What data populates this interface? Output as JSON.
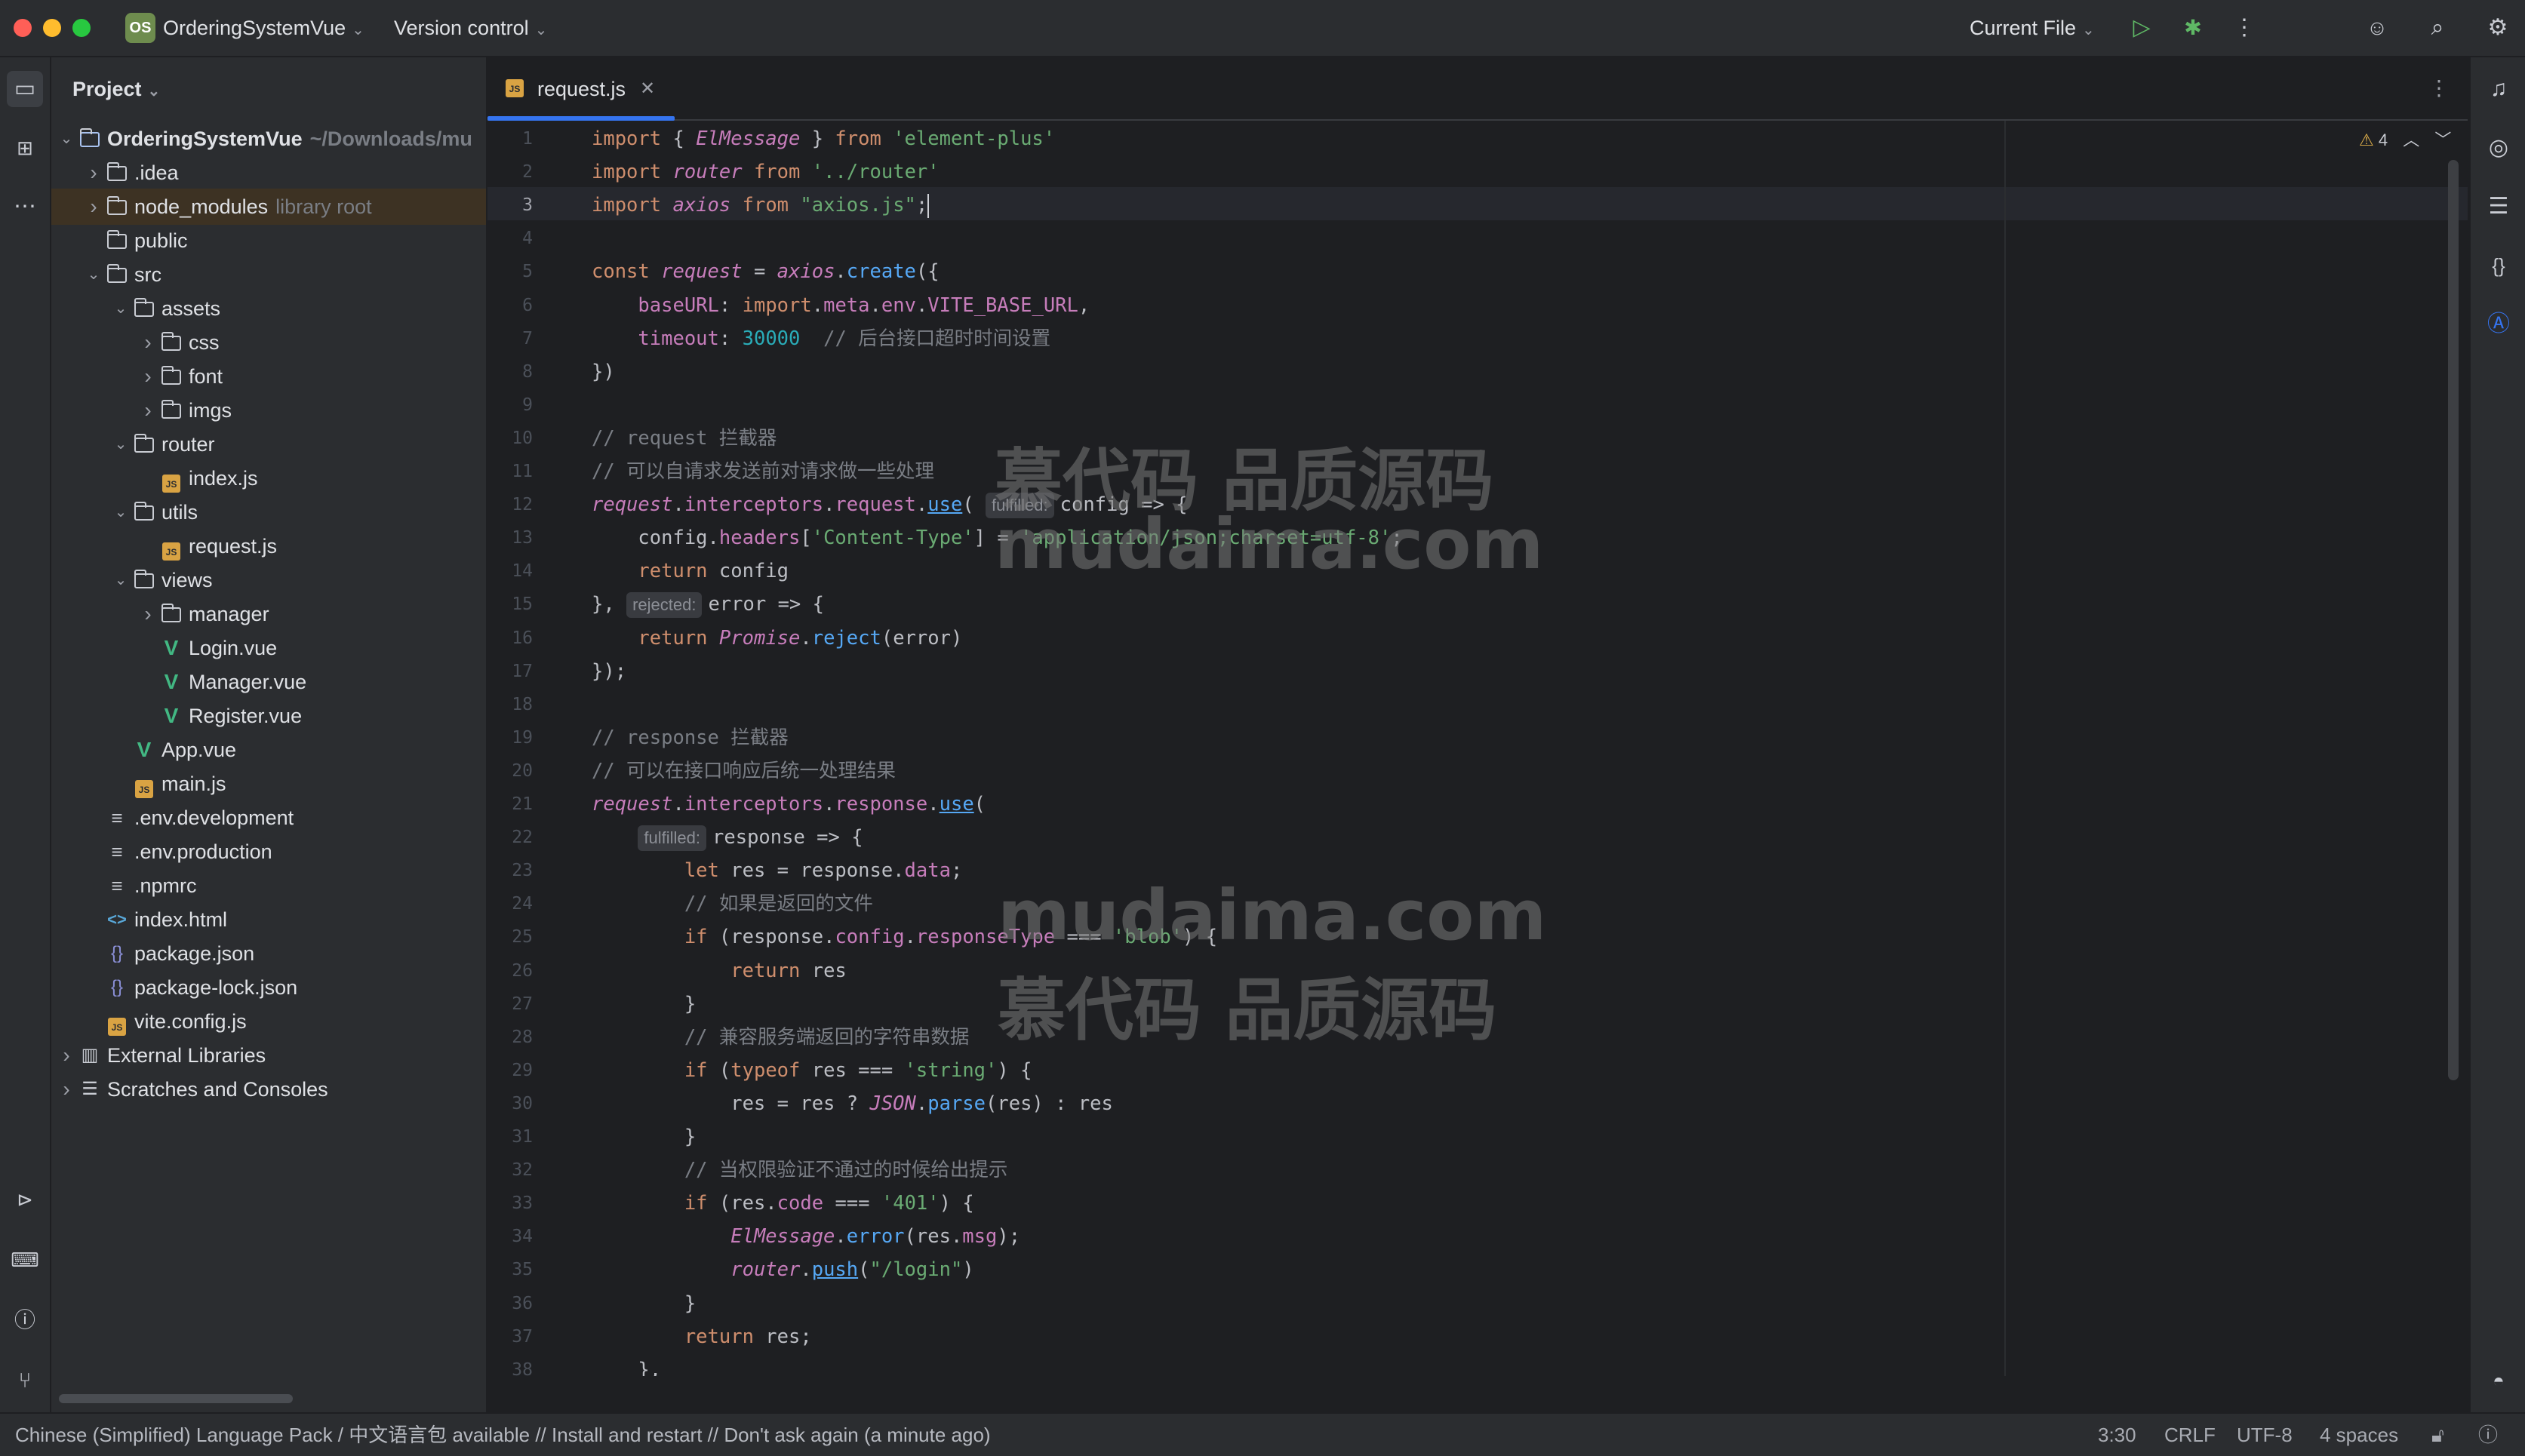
{
  "titlebar": {
    "project_badge": "OS",
    "project_name": "OrderingSystemVue",
    "vcs": "Version control",
    "run_config": "Current File"
  },
  "project_panel": {
    "header": "Project",
    "tree": [
      {
        "label": "OrderingSystemVue",
        "sub": "~/Downloads/mu",
        "icon": "project-folder-icon",
        "level": 0,
        "expanded": true,
        "bold": true
      },
      {
        "label": ".idea",
        "icon": "folder-icon",
        "level": 1,
        "collapsed": true
      },
      {
        "label": "node_modules",
        "sub": "library root",
        "icon": "folder-icon",
        "level": 1,
        "collapsed": true
      },
      {
        "label": "public",
        "icon": "folder-icon",
        "level": 1
      },
      {
        "label": "src",
        "icon": "folder-icon",
        "level": 1,
        "expanded": true
      },
      {
        "label": "assets",
        "icon": "folder-icon",
        "level": 2,
        "expanded": true
      },
      {
        "label": "css",
        "icon": "folder-icon",
        "level": 3,
        "collapsed": true
      },
      {
        "label": "font",
        "icon": "folder-icon",
        "level": 3,
        "collapsed": true
      },
      {
        "label": "imgs",
        "icon": "folder-icon",
        "level": 3,
        "collapsed": true
      },
      {
        "label": "router",
        "icon": "folder-icon",
        "level": 2,
        "expanded": true
      },
      {
        "label": "index.js",
        "icon": "js-file-icon",
        "level": 3
      },
      {
        "label": "utils",
        "icon": "folder-icon",
        "level": 2,
        "expanded": true
      },
      {
        "label": "request.js",
        "icon": "js-file-icon",
        "level": 3
      },
      {
        "label": "views",
        "icon": "folder-icon",
        "level": 2,
        "expanded": true
      },
      {
        "label": "manager",
        "icon": "folder-icon",
        "level": 3,
        "collapsed": true
      },
      {
        "label": "Login.vue",
        "icon": "vue-file-icon",
        "level": 3
      },
      {
        "label": "Manager.vue",
        "icon": "vue-file-icon",
        "level": 3
      },
      {
        "label": "Register.vue",
        "icon": "vue-file-icon",
        "level": 3
      },
      {
        "label": "App.vue",
        "icon": "vue-file-icon",
        "level": 2
      },
      {
        "label": "main.js",
        "icon": "js-file-icon",
        "level": 2
      },
      {
        "label": ".env.development",
        "icon": "text-file-icon",
        "level": 1
      },
      {
        "label": ".env.production",
        "icon": "text-file-icon",
        "level": 1
      },
      {
        "label": ".npmrc",
        "icon": "text-file-icon",
        "level": 1
      },
      {
        "label": "index.html",
        "icon": "html-file-icon",
        "level": 1
      },
      {
        "label": "package.json",
        "icon": "json-file-icon",
        "level": 1
      },
      {
        "label": "package-lock.json",
        "icon": "json-file-icon",
        "level": 1
      },
      {
        "label": "vite.config.js",
        "icon": "js-file-icon",
        "level": 1
      },
      {
        "label": "External Libraries",
        "icon": "library-icon",
        "level": 0,
        "collapsed": true
      },
      {
        "label": "Scratches and Consoles",
        "icon": "scratches-icon",
        "level": 0,
        "collapsed": true
      }
    ]
  },
  "editor": {
    "tab_label": "request.js",
    "warnings_count": "4",
    "current_line": 3,
    "lines": [
      "import { ElMessage } from 'element-plus'",
      "import router from '../router'",
      "import axios from \"axios.js\";",
      "",
      "const request = axios.create({",
      "    baseURL: import.meta.env.VITE_BASE_URL,",
      "    timeout: 30000  // 后台接口超时时间设置",
      "})",
      "",
      "// request 拦截器",
      "// 可以自请求发送前对请求做一些处理",
      "request.interceptors.request.use( config => {",
      "    config.headers['Content-Type'] = 'application/json;charset=utf-8';",
      "    return config",
      "},  error => {",
      "    return Promise.reject(error)",
      "});",
      "",
      "// response 拦截器",
      "// 可以在接口响应后统一处理结果",
      "request.interceptors.response.use(",
      "     response => {",
      "        let res = response.data;",
      "        // 如果是返回的文件",
      "        if (response.config.responseType === 'blob') {",
      "            return res",
      "        }",
      "        // 兼容服务端返回的字符串数据",
      "        if (typeof res === 'string') {",
      "            res = res ? JSON.parse(res) : res",
      "        }",
      "        // 当权限验证不通过的时候给出提示",
      "        if (res.code === '401') {",
      "            ElMessage.error(res.msg);",
      "            router.push(\"/login\")",
      "        }",
      "        return res;",
      "    },"
    ],
    "hints": {
      "fulfilled": "fulfilled:",
      "rejected": "rejected:"
    }
  },
  "watermark": {
    "line1": "慕代码 品质源码",
    "line2": "mudaima.com"
  },
  "statusbar": {
    "message": "Chinese (Simplified) Language Pack / 中文语言包 available // Install and restart // Don't ask again (a minute ago)",
    "position": "3:30",
    "line_ending": "CRLF",
    "encoding": "UTF-8",
    "indent": "4 spaces"
  },
  "colors": {
    "accent": "#3574f0",
    "panel_bg": "#2b2d30",
    "editor_bg": "#1e1f22",
    "keyword": "#cf8e6d",
    "string": "#6aab73",
    "comment": "#7a7e85"
  }
}
